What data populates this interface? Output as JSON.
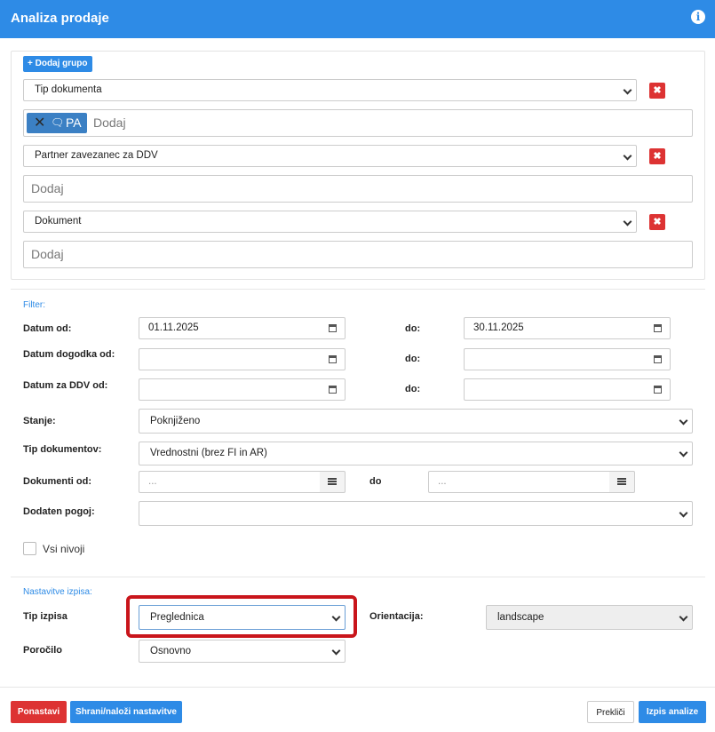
{
  "header": {
    "title": "Analiza prodaje",
    "info_icon": "i"
  },
  "grouping": {
    "add_group_label": "+ Dodaj grupo",
    "groups": [
      {
        "select_value": "Tip dokumenta",
        "chip": {
          "label": "PA"
        },
        "input_placeholder": "Dodaj"
      },
      {
        "select_value": "Partner zavezanec za DDV",
        "input_placeholder": "Dodaj"
      },
      {
        "select_value": "Dokument",
        "input_placeholder": "Dodaj"
      }
    ],
    "delete_icon": "✖"
  },
  "filter": {
    "section_title": "Filter:",
    "date_from_label": "Datum od:",
    "date_from": "01.11.2025",
    "date_to_label": "do:",
    "date_to": "30.11.2025",
    "event_date_label": "Datum dogodka od:",
    "event_to_label": "do:",
    "vat_date_label": "Datum za DDV od:",
    "vat_to_label": "do:",
    "state_label": "Stanje:",
    "state_value": "Poknjiženo",
    "doc_types_label": "Tip dokumentov:",
    "doc_types_value": "Vrednostni (brez FI in AR)",
    "docs_from_label": "Dokumenti od:",
    "docs_from_placeholder": "...",
    "docs_to_label": "do",
    "docs_to_placeholder": "...",
    "extra_condition_label": "Dodaten pogoj:",
    "extra_condition_value": "",
    "all_levels_label": "Vsi nivoji"
  },
  "output": {
    "section_title": "Nastavitve izpisa:",
    "print_type_label": "Tip izpisa",
    "print_type_value": "Preglednica",
    "orientation_label": "Orientacija:",
    "orientation_value": "landscape",
    "report_label": "Poročilo",
    "report_value": "Osnovno"
  },
  "footer": {
    "reset_label": "Ponastavi",
    "save_load_label": "Shrani/naloži nastavitve",
    "cancel_label": "Prekliči",
    "run_label": "Izpis analize"
  },
  "colors": {
    "accent": "#2e8be6",
    "danger": "#dd3333",
    "highlight": "#c9151b"
  }
}
